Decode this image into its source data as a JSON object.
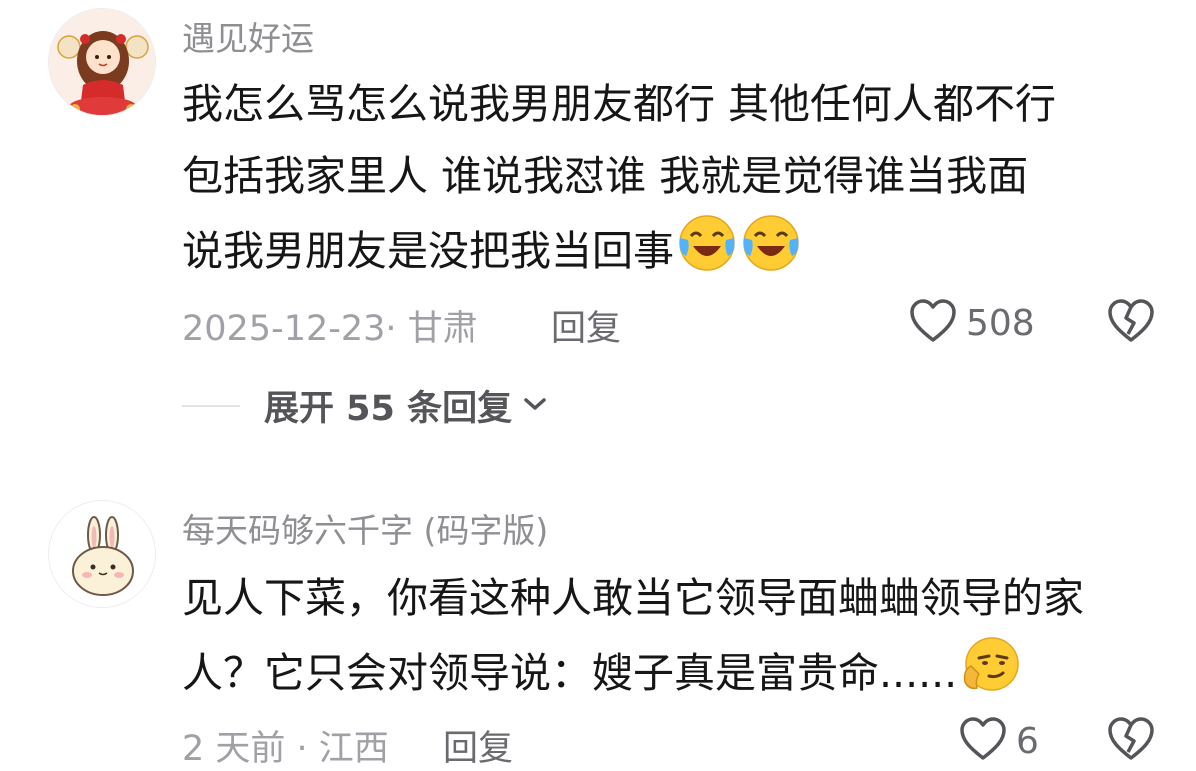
{
  "comments": [
    {
      "username": "遇见好运",
      "lines": [
        "我怎么骂怎么说我男朋友都行  其他任何人都不行",
        "包括我家里人  谁说我怼谁   我就是觉得谁当我面",
        "说我男朋友是没把我当回事"
      ],
      "emojis": [
        "laughing-crying",
        "laughing-crying"
      ],
      "date_location": "2025-12-23· 甘肃",
      "reply_label": "回复",
      "likes": "508",
      "expand_replies_label": "展开 55 条回复"
    },
    {
      "username": "每天码够六千字 (码字版)",
      "lines": [
        "见人下菜，你看这种人敢当它领导面蛐蛐领导的家",
        "人？它只会对领导说：嫂子真是富贵命......"
      ],
      "emojis": [
        "smirk-thinking"
      ],
      "date_location": "2 天前 · 江西",
      "reply_label": "回复",
      "likes": "6"
    }
  ],
  "colors": {
    "username": "#8e8e93",
    "text": "#161616",
    "meta": "#a0a0a6",
    "emoji_yellow": "#ffcc33"
  }
}
